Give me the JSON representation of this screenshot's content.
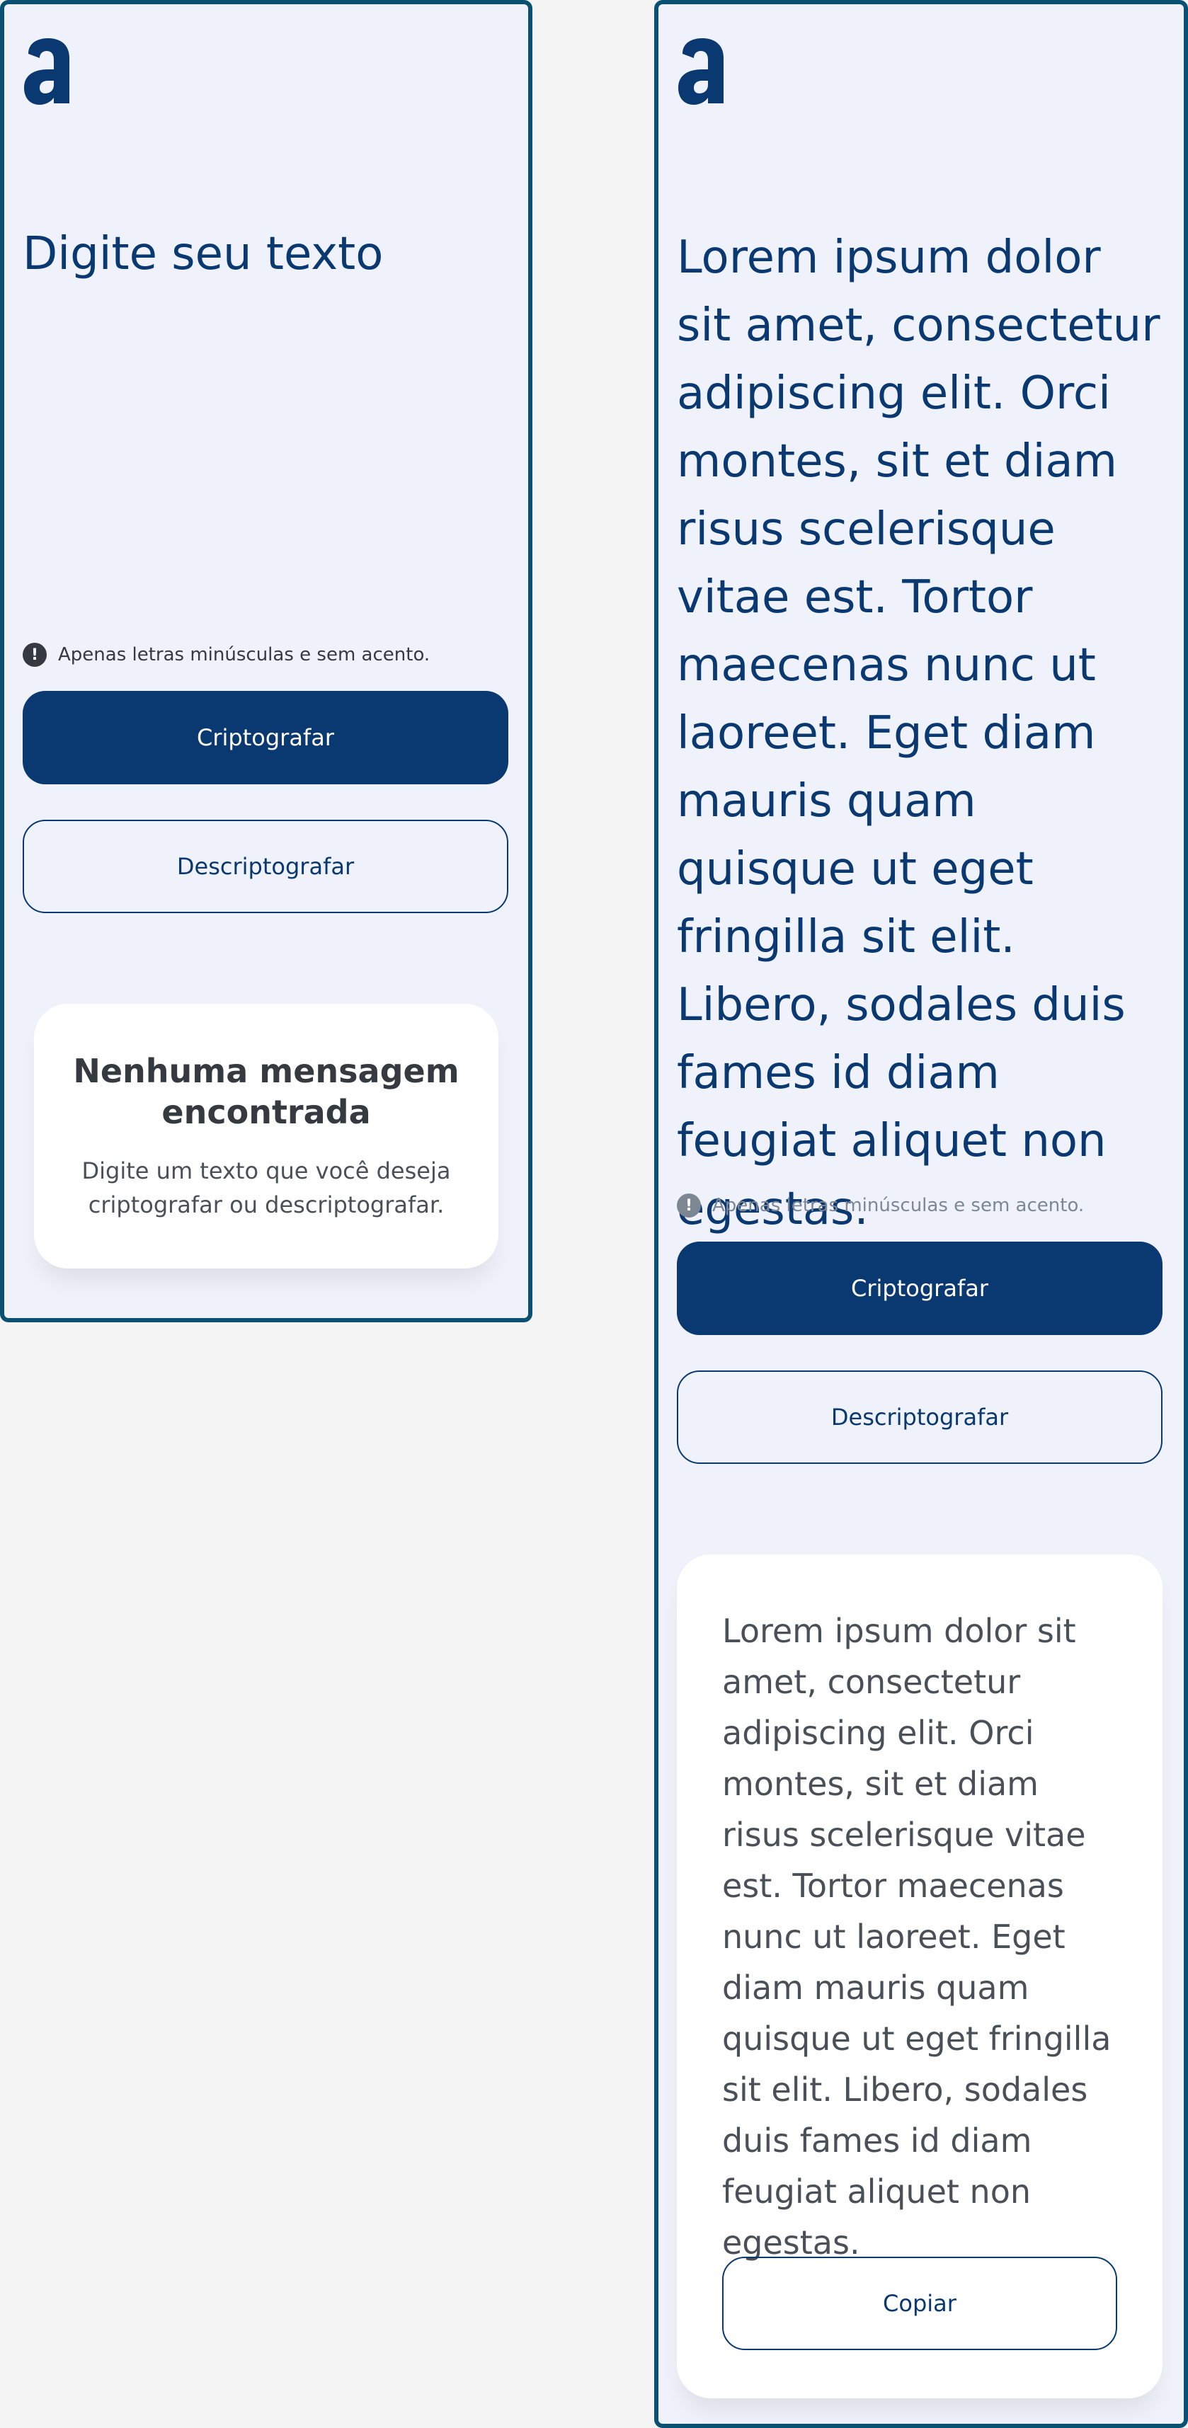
{
  "colors": {
    "accent": "#0a3871",
    "frame_border": "#0a5073",
    "screen_background": "#eff2fb",
    "page_background": "#f4f4f5"
  },
  "logo": {
    "icon": "alura-logo-icon"
  },
  "left_screen": {
    "input_placeholder": "Digite seu texto",
    "hint_icon": "exclamation-icon",
    "hint_text": "Apenas letras minúsculas e sem acento.",
    "encrypt_label": "Criptografar",
    "decrypt_label": "Descriptografar",
    "empty_title": "Nenhuma mensagem encontrada",
    "empty_description": "Digite um texto que você deseja criptografar ou descriptografar."
  },
  "right_screen": {
    "input_value": "Lorem ipsum dolor sit amet, consectetur adipiscing elit. Orci montes, sit et diam risus scelerisque vitae est. Tortor maecenas nunc ut laoreet. Eget diam mauris quam quisque ut eget fringilla sit elit. Libero, sodales duis fames id diam feugiat aliquet non egestas.",
    "hint_icon": "exclamation-icon",
    "hint_text": "Apenas letras minúsculas e sem acento.",
    "encrypt_label": "Criptografar",
    "decrypt_label": "Descriptografar",
    "result_text": "Lorem ipsum dolor sit amet, consectetur adipiscing elit. Orci montes, sit et diam risus scelerisque vitae est. Tortor maecenas nunc ut laoreet. Eget diam mauris quam quisque ut eget fringilla sit elit. Libero, sodales duis fames id diam feugiat aliquet non egestas.",
    "copy_label": "Copiar"
  }
}
